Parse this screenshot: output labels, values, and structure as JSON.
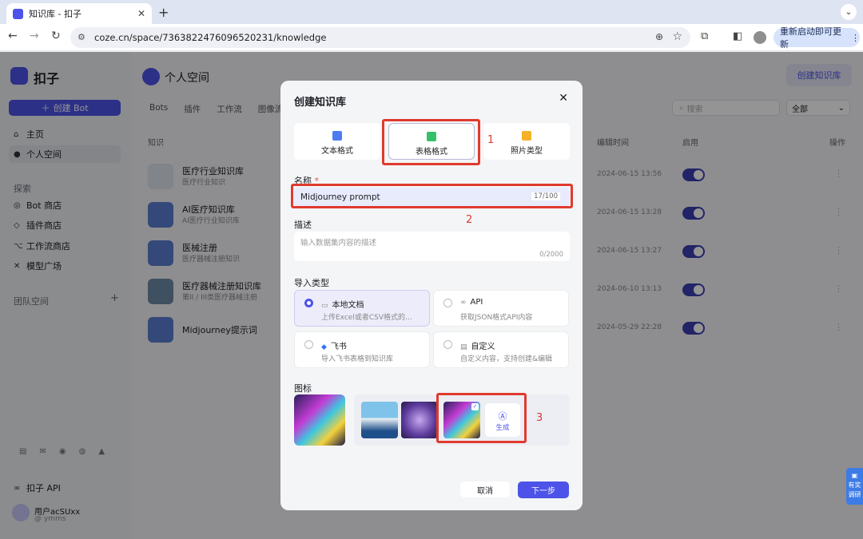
{
  "browser": {
    "tab_title": "知识库 - 扣子",
    "url": "coze.cn/space/7363822476096520231/knowledge",
    "update_label": "重新启动即可更新"
  },
  "sidebar": {
    "brand": "扣子",
    "create_bot": "创建 Bot",
    "items": [
      {
        "label": "主页",
        "icon": "home-icon"
      },
      {
        "label": "个人空间",
        "icon": "person-icon"
      }
    ],
    "explore_title": "探索",
    "explore_items": [
      {
        "label": "Bot 商店",
        "icon": "bot-icon"
      },
      {
        "label": "插件商店",
        "icon": "cube-icon"
      },
      {
        "label": "工作流商店",
        "icon": "flow-icon"
      },
      {
        "label": "模型广场",
        "icon": "model-icon"
      }
    ],
    "team_title": "团队空间",
    "api_label": "扣子 API",
    "user_name": "用户acSUxx",
    "user_handle": "@ ymms"
  },
  "main": {
    "space_title": "个人空间",
    "create_kb": "创建知识库",
    "tabs": [
      "Bots",
      "插件",
      "工作流",
      "图像流"
    ],
    "search_placeholder": "搜索",
    "filter_value": "全部",
    "col_knowledge": "知识",
    "col_edit_time": "编辑时间",
    "col_enabled": "启用",
    "col_ops": "操作",
    "rows": [
      {
        "name": "医疗行业知识库",
        "desc": "医疗行业知识",
        "date": "2024-06-15 13:56"
      },
      {
        "name": "AI医疗知识库",
        "desc": "AI医疗行业知识库",
        "date": "2024-06-15 13:28"
      },
      {
        "name": "医械注册",
        "desc": "医疗器械注册知识",
        "date": "2024-06-15 13:27"
      },
      {
        "name": "医疗器械注册知识库",
        "desc": "第II / III类医疗器械注册",
        "date": "2024-06-10 13:13"
      },
      {
        "name": "Midjourney提示词",
        "desc": "",
        "date": "2024-05-29 22:28"
      }
    ]
  },
  "modal": {
    "title": "创建知识库",
    "formats": [
      {
        "label": "文本格式",
        "color": "#4e7cf0"
      },
      {
        "label": "表格格式",
        "color": "#34c169"
      },
      {
        "label": "照片类型",
        "color": "#f5b129"
      }
    ],
    "name_label": "名称",
    "required_mark": "*",
    "name_value": "Midjourney prompt",
    "name_count": "17/100",
    "desc_label": "描述",
    "desc_placeholder": "输入数据集内容的描述",
    "desc_count": "0/2000",
    "import_label": "导入类型",
    "import_options": [
      {
        "title": "本地文档",
        "sub": "上传Excel或者CSV格式的...",
        "icon": "folder-icon",
        "selected": true
      },
      {
        "title": "API",
        "sub": "获取JSON格式API内容",
        "icon": "link-icon",
        "selected": false
      },
      {
        "title": "飞书",
        "sub": "导入飞书表格到知识库",
        "icon": "feishu-icon",
        "selected": false
      },
      {
        "title": "自定义",
        "sub": "自定义内容，支持创建&编辑",
        "icon": "doc-icon",
        "selected": false
      }
    ],
    "icon_label": "图标",
    "generate_label": "生成",
    "cancel": "取消",
    "next": "下一步"
  },
  "annotations": [
    "1",
    "2",
    "3"
  ],
  "survey": "有奖调研"
}
